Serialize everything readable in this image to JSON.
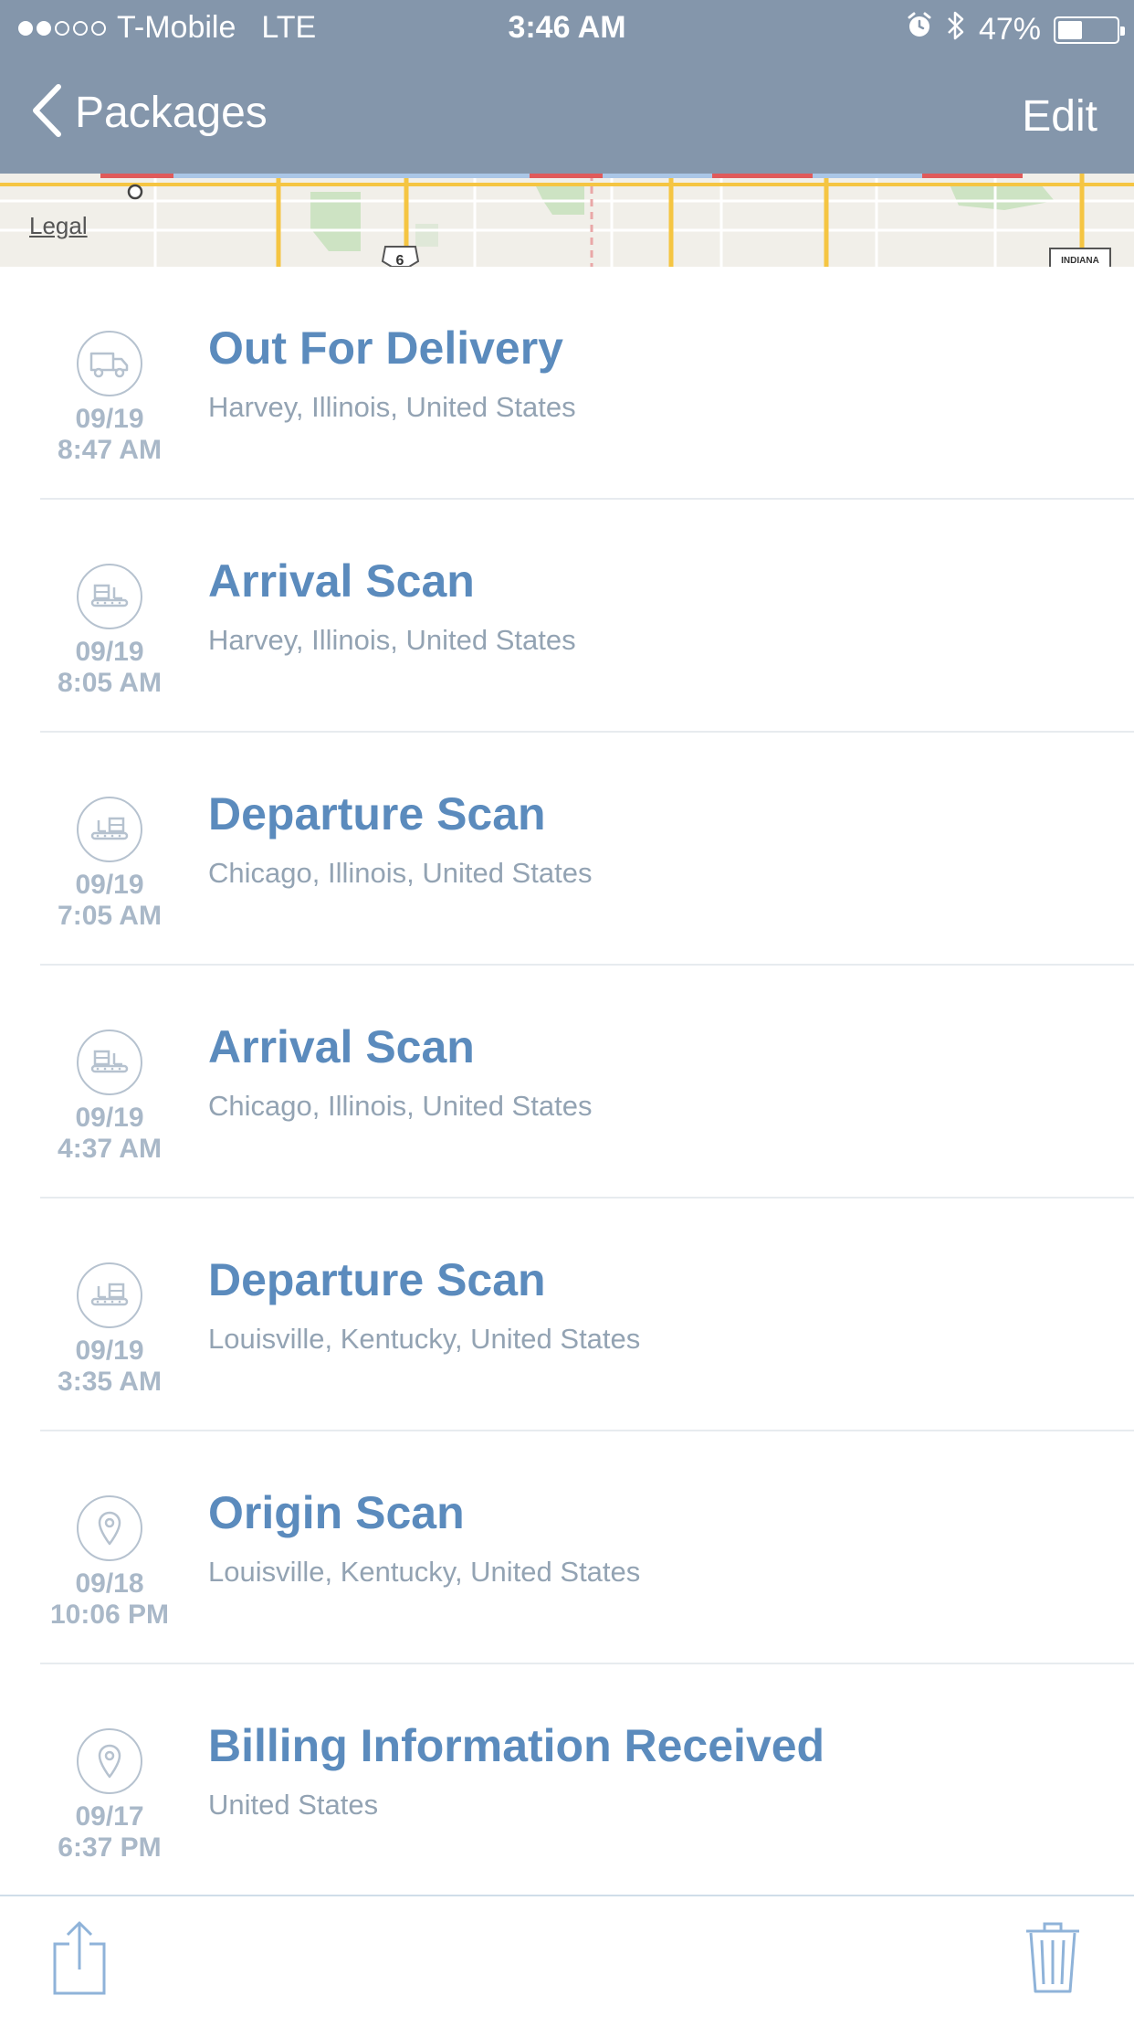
{
  "status_bar": {
    "carrier": "T-Mobile",
    "network": "LTE",
    "time": "3:46 AM",
    "battery_percent": "47%",
    "battery_level": 0.47,
    "signal_bars_filled": 2,
    "signal_bars_total": 5,
    "icons": [
      "alarm-icon",
      "bluetooth-icon",
      "battery-icon"
    ]
  },
  "nav": {
    "back_label": "Packages",
    "edit_label": "Edit"
  },
  "map": {
    "legal_label": "Legal",
    "shield_label": "6",
    "sign_label": "INDIANA"
  },
  "events": [
    {
      "icon": "truck-icon",
      "title": "Out For Delivery",
      "location": "Harvey, Illinois, United States",
      "date": "09/19",
      "time": "8:47 AM"
    },
    {
      "icon": "warehouse-arrival-icon",
      "title": "Arrival Scan",
      "location": "Harvey, Illinois, United States",
      "date": "09/19",
      "time": "8:05 AM"
    },
    {
      "icon": "warehouse-departure-icon",
      "title": "Departure Scan",
      "location": "Chicago, Illinois, United States",
      "date": "09/19",
      "time": "7:05 AM"
    },
    {
      "icon": "warehouse-arrival-icon",
      "title": "Arrival Scan",
      "location": "Chicago, Illinois, United States",
      "date": "09/19",
      "time": "4:37 AM"
    },
    {
      "icon": "warehouse-departure-icon",
      "title": "Departure Scan",
      "location": "Louisville, Kentucky, United States",
      "date": "09/19",
      "time": "3:35 AM"
    },
    {
      "icon": "location-pin-icon",
      "title": "Origin Scan",
      "location": "Louisville, Kentucky, United States",
      "date": "09/18",
      "time": "10:06 PM"
    },
    {
      "icon": "location-pin-icon",
      "title": "Billing Information Received",
      "location": "United States",
      "date": "09/17",
      "time": "6:37 PM"
    }
  ],
  "toolbar": {
    "icons": [
      "share-icon",
      "trash-icon"
    ]
  },
  "colors": {
    "header_bg": "#8496ab",
    "title_blue": "#5b8bbd",
    "location_gray": "#93a3b3",
    "date_gray": "#a9b8c8",
    "icon_stroke": "#b6c2cf",
    "toolbar_icon": "#8fb3d9"
  }
}
